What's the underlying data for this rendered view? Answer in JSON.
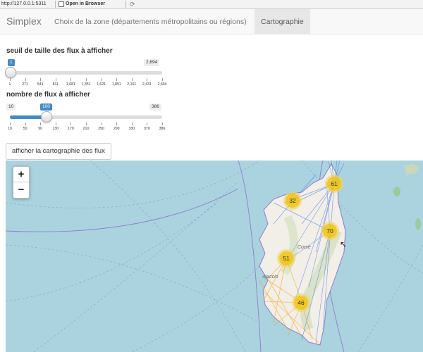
{
  "browser": {
    "url": "http://127.0.0.1:5311",
    "open_in_browser": "Open in Browser"
  },
  "navbar": {
    "brand": "Simplex",
    "tabs": [
      {
        "label": "Choix de la zone (départements métropolitains ou régions)",
        "active": false
      },
      {
        "label": "Cartographie",
        "active": true
      }
    ]
  },
  "slider_size": {
    "label": "seuil de taille des flux à afficher",
    "value": 1,
    "min": 1,
    "max": 2694,
    "max_label": "2,694",
    "ticks": [
      "1",
      "271",
      "541",
      "811",
      "1,081",
      "1,351",
      "1,621",
      "1,891",
      "2,161",
      "2,431",
      "2,694"
    ]
  },
  "slider_count": {
    "label": "nombre de flux à afficher",
    "value": 100,
    "min": 10,
    "max": 386,
    "ticks": [
      "10",
      "50",
      "90",
      "130",
      "170",
      "210",
      "250",
      "290",
      "330",
      "370",
      "386"
    ]
  },
  "button": {
    "label": "afficher la cartographie des flux"
  },
  "map": {
    "zoom_in": "+",
    "zoom_out": "−",
    "place_labels": [
      "Corse",
      "Ajaccio"
    ],
    "clusters": [
      {
        "count": "61",
        "pos": "north"
      },
      {
        "count": "32",
        "pos": "northwest"
      },
      {
        "count": "70",
        "pos": "east"
      },
      {
        "count": "51",
        "pos": "center"
      },
      {
        "count": "46",
        "pos": "south"
      }
    ],
    "colors": {
      "sea": "#aad3df",
      "land": "#f2efe9",
      "flow_blue": "#3b6fd8",
      "flow_orange": "#f5a623",
      "cluster": "#f0c20c"
    }
  }
}
